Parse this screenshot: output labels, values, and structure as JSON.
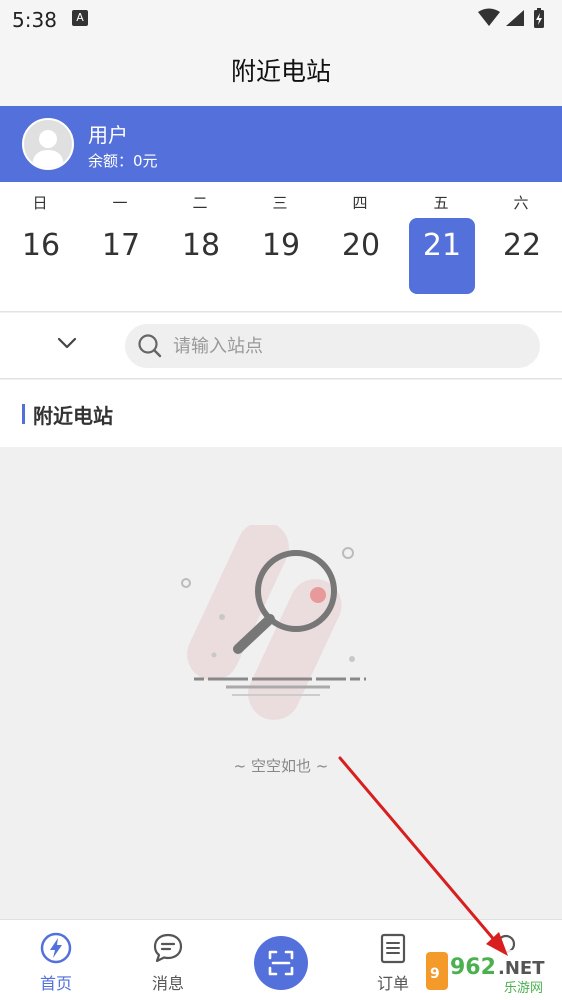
{
  "status": {
    "time": "5:38",
    "a_badge": "A"
  },
  "title": "附近电站",
  "user": {
    "name": "用户",
    "balance": "余额：0元"
  },
  "calendar": {
    "days": [
      {
        "weekday": "日",
        "day": "16",
        "active": false
      },
      {
        "weekday": "一",
        "day": "17",
        "active": false
      },
      {
        "weekday": "二",
        "day": "18",
        "active": false
      },
      {
        "weekday": "三",
        "day": "19",
        "active": false
      },
      {
        "weekday": "四",
        "day": "20",
        "active": false
      },
      {
        "weekday": "五",
        "day": "21",
        "active": true
      },
      {
        "weekday": "六",
        "day": "22",
        "active": false
      }
    ]
  },
  "search": {
    "placeholder": "请输入站点",
    "value": ""
  },
  "section": {
    "title": "附近电站"
  },
  "empty": {
    "text": "~ 空空如也 ~"
  },
  "tabs": [
    {
      "label": "首页",
      "icon": "bolt-circle-icon",
      "active": true
    },
    {
      "label": "消息",
      "icon": "chat-bubble-icon",
      "active": false
    },
    {
      "label": "",
      "icon": "scan-icon",
      "active": false
    },
    {
      "label": "订单",
      "icon": "order-list-icon",
      "active": false
    },
    {
      "label": "",
      "icon": "profile-icon",
      "active": false
    }
  ],
  "watermark": {
    "number": "962",
    "suffix": ".NET",
    "caption": "乐游网"
  },
  "colors": {
    "accent": "#5470db",
    "arrow": "#d81e1e"
  }
}
